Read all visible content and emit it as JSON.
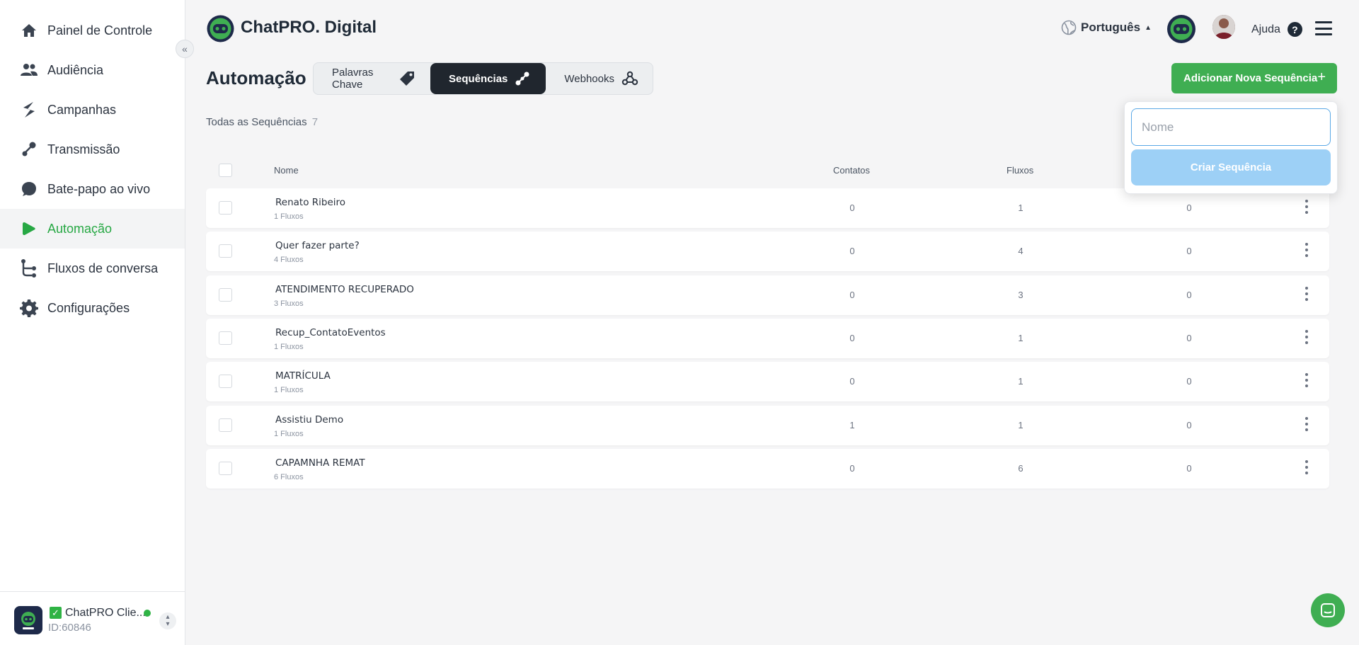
{
  "sidebar": {
    "items": [
      {
        "label": "Painel de Controle",
        "icon": "home-icon"
      },
      {
        "label": "Audiência",
        "icon": "users-icon"
      },
      {
        "label": "Campanhas",
        "icon": "campaign-icon"
      },
      {
        "label": "Transmissão",
        "icon": "broadcast-icon"
      },
      {
        "label": "Bate-papo ao vivo",
        "icon": "chat-bubble-icon"
      },
      {
        "label": "Automação",
        "icon": "play-icon",
        "active": true
      },
      {
        "label": "Fluxos de conversa",
        "icon": "flow-icon"
      },
      {
        "label": "Configurações",
        "icon": "gear-icon"
      }
    ],
    "account": {
      "name": "ChatPRO Clie...",
      "id": "ID:60846",
      "status_color": "#2fb344"
    }
  },
  "header": {
    "brand": "ChatPRO. Digital",
    "language": "Português",
    "help_label": "Ajuda",
    "help_glyph": "?"
  },
  "page": {
    "title": "Automação",
    "tabs": [
      {
        "label": "Palavras Chave",
        "icon": "tag-icon"
      },
      {
        "label": "Sequências",
        "icon": "sequence-icon",
        "active": true
      },
      {
        "label": "Webhooks",
        "icon": "webhook-icon"
      }
    ],
    "add_button": "Adicionar Nova Sequência",
    "add_button_plus": "+",
    "subheading": "Todas as Sequências",
    "subheading_count": "7"
  },
  "table": {
    "columns": {
      "name": "Nome",
      "contacts": "Contatos",
      "flows": "Fluxos"
    },
    "rows": [
      {
        "name": "Renato Ribeiro",
        "sub": "1 Fluxos",
        "contacts": "0",
        "flows": "1",
        "third": "0"
      },
      {
        "name": "Quer fazer parte?",
        "sub": "4 Fluxos",
        "contacts": "0",
        "flows": "4",
        "third": "0"
      },
      {
        "name": "ATENDIMENTO RECUPERADO",
        "sub": "3 Fluxos",
        "contacts": "0",
        "flows": "3",
        "third": "0"
      },
      {
        "name": "Recup_ContatoEventos",
        "sub": "1 Fluxos",
        "contacts": "0",
        "flows": "1",
        "third": "0"
      },
      {
        "name": "MATRÍCULA",
        "sub": "1 Fluxos",
        "contacts": "0",
        "flows": "1",
        "third": "0"
      },
      {
        "name": "Assistiu Demo",
        "sub": "1 Fluxos",
        "contacts": "1",
        "flows": "1",
        "third": "0"
      },
      {
        "name": "CAPAMNHA REMAT",
        "sub": "6 Fluxos",
        "contacts": "0",
        "flows": "6",
        "third": "0"
      }
    ]
  },
  "popover": {
    "placeholder": "Nome",
    "value": "",
    "create_button": "Criar Sequência"
  },
  "colors": {
    "accent": "#3fae52",
    "active_nav": "#27a844",
    "primary_disabled": "#9dd0f6",
    "dark_tab": "#20262e"
  }
}
